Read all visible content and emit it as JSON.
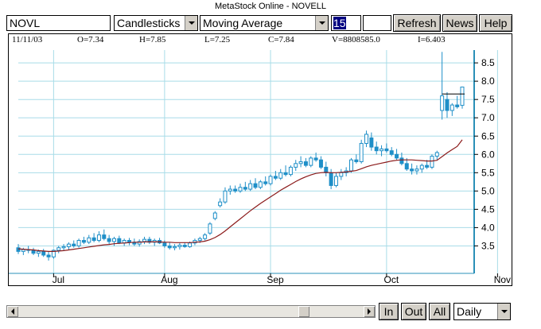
{
  "window": {
    "title": "MetaStock Online - NOVELL"
  },
  "toolbar": {
    "symbol": "NOVL",
    "chart_style": "Candlesticks",
    "indicator": "Moving Average",
    "period": "15",
    "refresh_label": "Refresh",
    "news_label": "News",
    "help_label": "Help"
  },
  "info": {
    "date": "11/11/03",
    "open": "O=7.34",
    "high": "H=7.85",
    "low": "L=7.25",
    "close": "C=7.84",
    "volume": "V=8808585.0",
    "indicator_value": "I=6.403"
  },
  "bottom": {
    "in_label": "In",
    "out_label": "Out",
    "all_label": "All",
    "interval": "Daily"
  },
  "colors": {
    "candle": "#1f8fc8",
    "moving_average": "#8b1a1a",
    "grid": "#a8dce8",
    "axis_line": "#2a90b8"
  },
  "chart_data": {
    "type": "candlestick",
    "x_tick_labels": [
      "Jul",
      "Aug",
      "Sep",
      "Oct",
      "Nov"
    ],
    "y_tick_labels": [
      "3.5",
      "4.0",
      "4.5",
      "5.0",
      "5.5",
      "6.0",
      "6.5",
      "7.0",
      "7.5",
      "8.0",
      "8.5"
    ],
    "y_ticks": [
      3.5,
      4.0,
      4.5,
      5.0,
      5.5,
      6.0,
      6.5,
      7.0,
      7.5,
      8.0,
      8.5
    ],
    "ylim": [
      2.75,
      8.85
    ],
    "month_start_index": [
      7,
      29,
      50,
      73,
      95
    ],
    "candles": [
      [
        3.45,
        3.55,
        3.28,
        3.35
      ],
      [
        3.35,
        3.45,
        3.25,
        3.4
      ],
      [
        3.4,
        3.5,
        3.3,
        3.38
      ],
      [
        3.38,
        3.45,
        3.25,
        3.3
      ],
      [
        3.3,
        3.4,
        3.2,
        3.35
      ],
      [
        3.35,
        3.42,
        3.2,
        3.25
      ],
      [
        3.25,
        3.35,
        3.1,
        3.2
      ],
      [
        3.2,
        3.4,
        3.15,
        3.38
      ],
      [
        3.38,
        3.5,
        3.3,
        3.45
      ],
      [
        3.45,
        3.55,
        3.38,
        3.48
      ],
      [
        3.48,
        3.6,
        3.4,
        3.55
      ],
      [
        3.55,
        3.65,
        3.45,
        3.5
      ],
      [
        3.5,
        3.7,
        3.45,
        3.65
      ],
      [
        3.65,
        3.75,
        3.55,
        3.6
      ],
      [
        3.6,
        3.8,
        3.55,
        3.72
      ],
      [
        3.72,
        3.85,
        3.6,
        3.65
      ],
      [
        3.65,
        3.9,
        3.6,
        3.8
      ],
      [
        3.8,
        3.95,
        3.65,
        3.7
      ],
      [
        3.7,
        3.8,
        3.55,
        3.62
      ],
      [
        3.62,
        3.75,
        3.5,
        3.7
      ],
      [
        3.7,
        3.78,
        3.55,
        3.58
      ],
      [
        3.58,
        3.7,
        3.5,
        3.65
      ],
      [
        3.65,
        3.72,
        3.52,
        3.6
      ],
      [
        3.6,
        3.7,
        3.5,
        3.55
      ],
      [
        3.55,
        3.68,
        3.48,
        3.62
      ],
      [
        3.62,
        3.75,
        3.55,
        3.68
      ],
      [
        3.68,
        3.75,
        3.55,
        3.6
      ],
      [
        3.6,
        3.7,
        3.5,
        3.65
      ],
      [
        3.65,
        3.72,
        3.55,
        3.58
      ],
      [
        3.58,
        3.65,
        3.45,
        3.5
      ],
      [
        3.5,
        3.6,
        3.4,
        3.45
      ],
      [
        3.45,
        3.55,
        3.38,
        3.48
      ],
      [
        3.48,
        3.58,
        3.4,
        3.52
      ],
      [
        3.52,
        3.6,
        3.45,
        3.48
      ],
      [
        3.48,
        3.62,
        3.45,
        3.58
      ],
      [
        3.58,
        3.7,
        3.52,
        3.65
      ],
      [
        3.65,
        3.75,
        3.58,
        3.7
      ],
      [
        3.7,
        3.85,
        3.65,
        3.8
      ],
      [
        3.85,
        4.15,
        3.8,
        4.1
      ],
      [
        4.25,
        4.45,
        4.2,
        4.4
      ],
      [
        4.6,
        4.8,
        4.55,
        4.7
      ],
      [
        4.7,
        5.1,
        4.65,
        5.0
      ],
      [
        5.0,
        5.15,
        4.9,
        5.05
      ],
      [
        5.05,
        5.15,
        4.95,
        5.0
      ],
      [
        5.0,
        5.2,
        4.95,
        5.1
      ],
      [
        5.1,
        5.25,
        5.0,
        5.05
      ],
      [
        5.05,
        5.3,
        5.0,
        5.2
      ],
      [
        5.2,
        5.35,
        5.05,
        5.1
      ],
      [
        5.1,
        5.3,
        5.05,
        5.25
      ],
      [
        5.25,
        5.4,
        5.15,
        5.2
      ],
      [
        5.2,
        5.45,
        5.15,
        5.4
      ],
      [
        5.4,
        5.55,
        5.3,
        5.35
      ],
      [
        5.35,
        5.6,
        5.3,
        5.5
      ],
      [
        5.5,
        5.7,
        5.4,
        5.45
      ],
      [
        5.45,
        5.7,
        5.4,
        5.65
      ],
      [
        5.65,
        5.85,
        5.55,
        5.75
      ],
      [
        5.75,
        5.95,
        5.65,
        5.8
      ],
      [
        5.8,
        5.9,
        5.65,
        5.7
      ],
      [
        5.7,
        5.95,
        5.65,
        5.9
      ],
      [
        5.9,
        6.05,
        5.8,
        5.85
      ],
      [
        5.85,
        5.95,
        5.6,
        5.65
      ],
      [
        5.65,
        5.8,
        5.4,
        5.5
      ],
      [
        5.5,
        5.6,
        5.05,
        5.15
      ],
      [
        5.15,
        5.5,
        5.1,
        5.4
      ],
      [
        5.4,
        5.6,
        5.3,
        5.5
      ],
      [
        5.5,
        5.65,
        5.4,
        5.55
      ],
      [
        5.55,
        5.9,
        5.5,
        5.85
      ],
      [
        5.85,
        6.0,
        5.75,
        5.8
      ],
      [
        5.8,
        6.4,
        5.75,
        6.3
      ],
      [
        6.3,
        6.65,
        6.2,
        6.55
      ],
      [
        6.45,
        6.6,
        6.1,
        6.2
      ],
      [
        6.2,
        6.35,
        6.0,
        6.1
      ],
      [
        6.1,
        6.25,
        5.95,
        6.15
      ],
      [
        6.15,
        6.3,
        6.05,
        6.1
      ],
      [
        6.1,
        6.2,
        5.95,
        6.0
      ],
      [
        6.0,
        6.15,
        5.85,
        5.9
      ],
      [
        5.9,
        6.05,
        5.7,
        5.75
      ],
      [
        5.75,
        5.9,
        5.55,
        5.6
      ],
      [
        5.6,
        5.75,
        5.45,
        5.55
      ],
      [
        5.55,
        5.7,
        5.45,
        5.6
      ],
      [
        5.6,
        5.75,
        5.5,
        5.7
      ],
      [
        5.7,
        5.85,
        5.6,
        5.65
      ],
      [
        5.65,
        6.0,
        5.6,
        5.95
      ],
      [
        5.95,
        6.1,
        5.85,
        6.05
      ],
      [
        7.2,
        8.8,
        6.95,
        7.6
      ],
      [
        7.5,
        7.7,
        7.0,
        7.2
      ],
      [
        7.2,
        7.4,
        7.05,
        7.35
      ],
      [
        7.35,
        7.6,
        7.25,
        7.3
      ],
      [
        7.34,
        7.85,
        7.25,
        7.84
      ]
    ],
    "moving_average": [
      3.42,
      3.41,
      3.4,
      3.39,
      3.37,
      3.36,
      3.35,
      3.35,
      3.36,
      3.37,
      3.39,
      3.41,
      3.43,
      3.45,
      3.47,
      3.49,
      3.51,
      3.53,
      3.54,
      3.56,
      3.57,
      3.58,
      3.59,
      3.6,
      3.6,
      3.61,
      3.61,
      3.61,
      3.61,
      3.6,
      3.6,
      3.59,
      3.59,
      3.59,
      3.59,
      3.6,
      3.61,
      3.63,
      3.67,
      3.73,
      3.81,
      3.91,
      4.02,
      4.13,
      4.24,
      4.35,
      4.46,
      4.56,
      4.66,
      4.75,
      4.84,
      4.93,
      5.02,
      5.1,
      5.18,
      5.26,
      5.33,
      5.39,
      5.44,
      5.48,
      5.5,
      5.51,
      5.5,
      5.5,
      5.51,
      5.52,
      5.54,
      5.56,
      5.61,
      5.66,
      5.7,
      5.73,
      5.76,
      5.79,
      5.82,
      5.84,
      5.85,
      5.85,
      5.85,
      5.84,
      5.83,
      5.82,
      5.82,
      5.84,
      5.94,
      6.04,
      6.13,
      6.22,
      6.4
    ]
  }
}
